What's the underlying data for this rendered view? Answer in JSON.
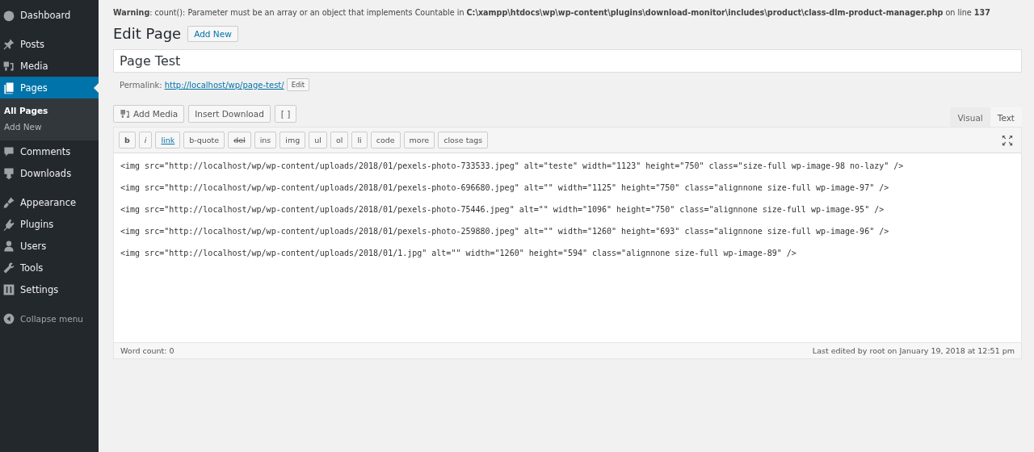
{
  "sidebar": {
    "groups": [
      [
        {
          "label": "Dashboard",
          "selected": false
        }
      ],
      [
        {
          "label": "Posts",
          "selected": false
        },
        {
          "label": "Media",
          "selected": false
        },
        {
          "label": "Pages",
          "selected": true,
          "children": [
            {
              "label": "All Pages",
              "selected": true
            },
            {
              "label": "Add New",
              "selected": false
            }
          ]
        },
        {
          "label": "Comments",
          "selected": false
        },
        {
          "label": "Downloads",
          "selected": false
        }
      ],
      [
        {
          "label": "Appearance",
          "selected": false
        },
        {
          "label": "Plugins",
          "selected": false
        },
        {
          "label": "Users",
          "selected": false
        },
        {
          "label": "Tools",
          "selected": false
        },
        {
          "label": "Settings",
          "selected": false
        }
      ]
    ],
    "collapse": "Collapse menu"
  },
  "warning": "**Warning**: count(): Parameter must be an array or an object that implements Countable in **C:\\xampp\\htdocs\\wp\\wp-content\\plugins\\download-monitor\\includes\\product\\class-dlm-product-manager.php** on line **137**",
  "heading": {
    "title": "Edit Page",
    "button": "Add New"
  },
  "post_title": {
    "value": "Page Test"
  },
  "permalink": {
    "label": "Permalink:",
    "url": "http://localhost/wp/page-test/",
    "button": "Edit"
  },
  "media_buttons": [
    "Add Media",
    "Insert Download",
    "[ ]"
  ],
  "editor_tabs": [
    {
      "label": "Visual",
      "selected": false
    },
    {
      "label": "Text",
      "selected": true
    }
  ],
  "quicktags": [
    "b",
    "i",
    "link",
    "b-quote",
    "del",
    "ins",
    "img",
    "ul",
    "ol",
    "li",
    "code",
    "more",
    "close tags"
  ],
  "content": [
    "<img src=\"http://localhost/wp/wp-content/uploads/2018/01/pexels-photo-733533.jpeg\" alt=\"teste\" width=\"1123\" height=\"750\" class=\"size-full wp-image-98 no-lazy\" />",
    "<img src=\"http://localhost/wp/wp-content/uploads/2018/01/pexels-photo-696680.jpeg\" alt=\"\" width=\"1125\" height=\"750\" class=\"alignnone size-full wp-image-97\" />",
    "<img src=\"http://localhost/wp/wp-content/uploads/2018/01/pexels-photo-75446.jpeg\" alt=\"\" width=\"1096\" height=\"750\" class=\"alignnone size-full wp-image-95\" />",
    "<img src=\"http://localhost/wp/wp-content/uploads/2018/01/pexels-photo-259880.jpeg\" alt=\"\" width=\"1260\" height=\"693\" class=\"alignnone size-full wp-image-96\" />",
    "<img src=\"http://localhost/wp/wp-content/uploads/2018/01/1.jpg\" alt=\"\" width=\"1260\" height=\"594\" class=\"alignnone size-full wp-image-89\" />"
  ],
  "status": {
    "word_count": "Word count: 0",
    "last_edited": "Last edited by root on January 19, 2018 at 12:51 pm"
  }
}
